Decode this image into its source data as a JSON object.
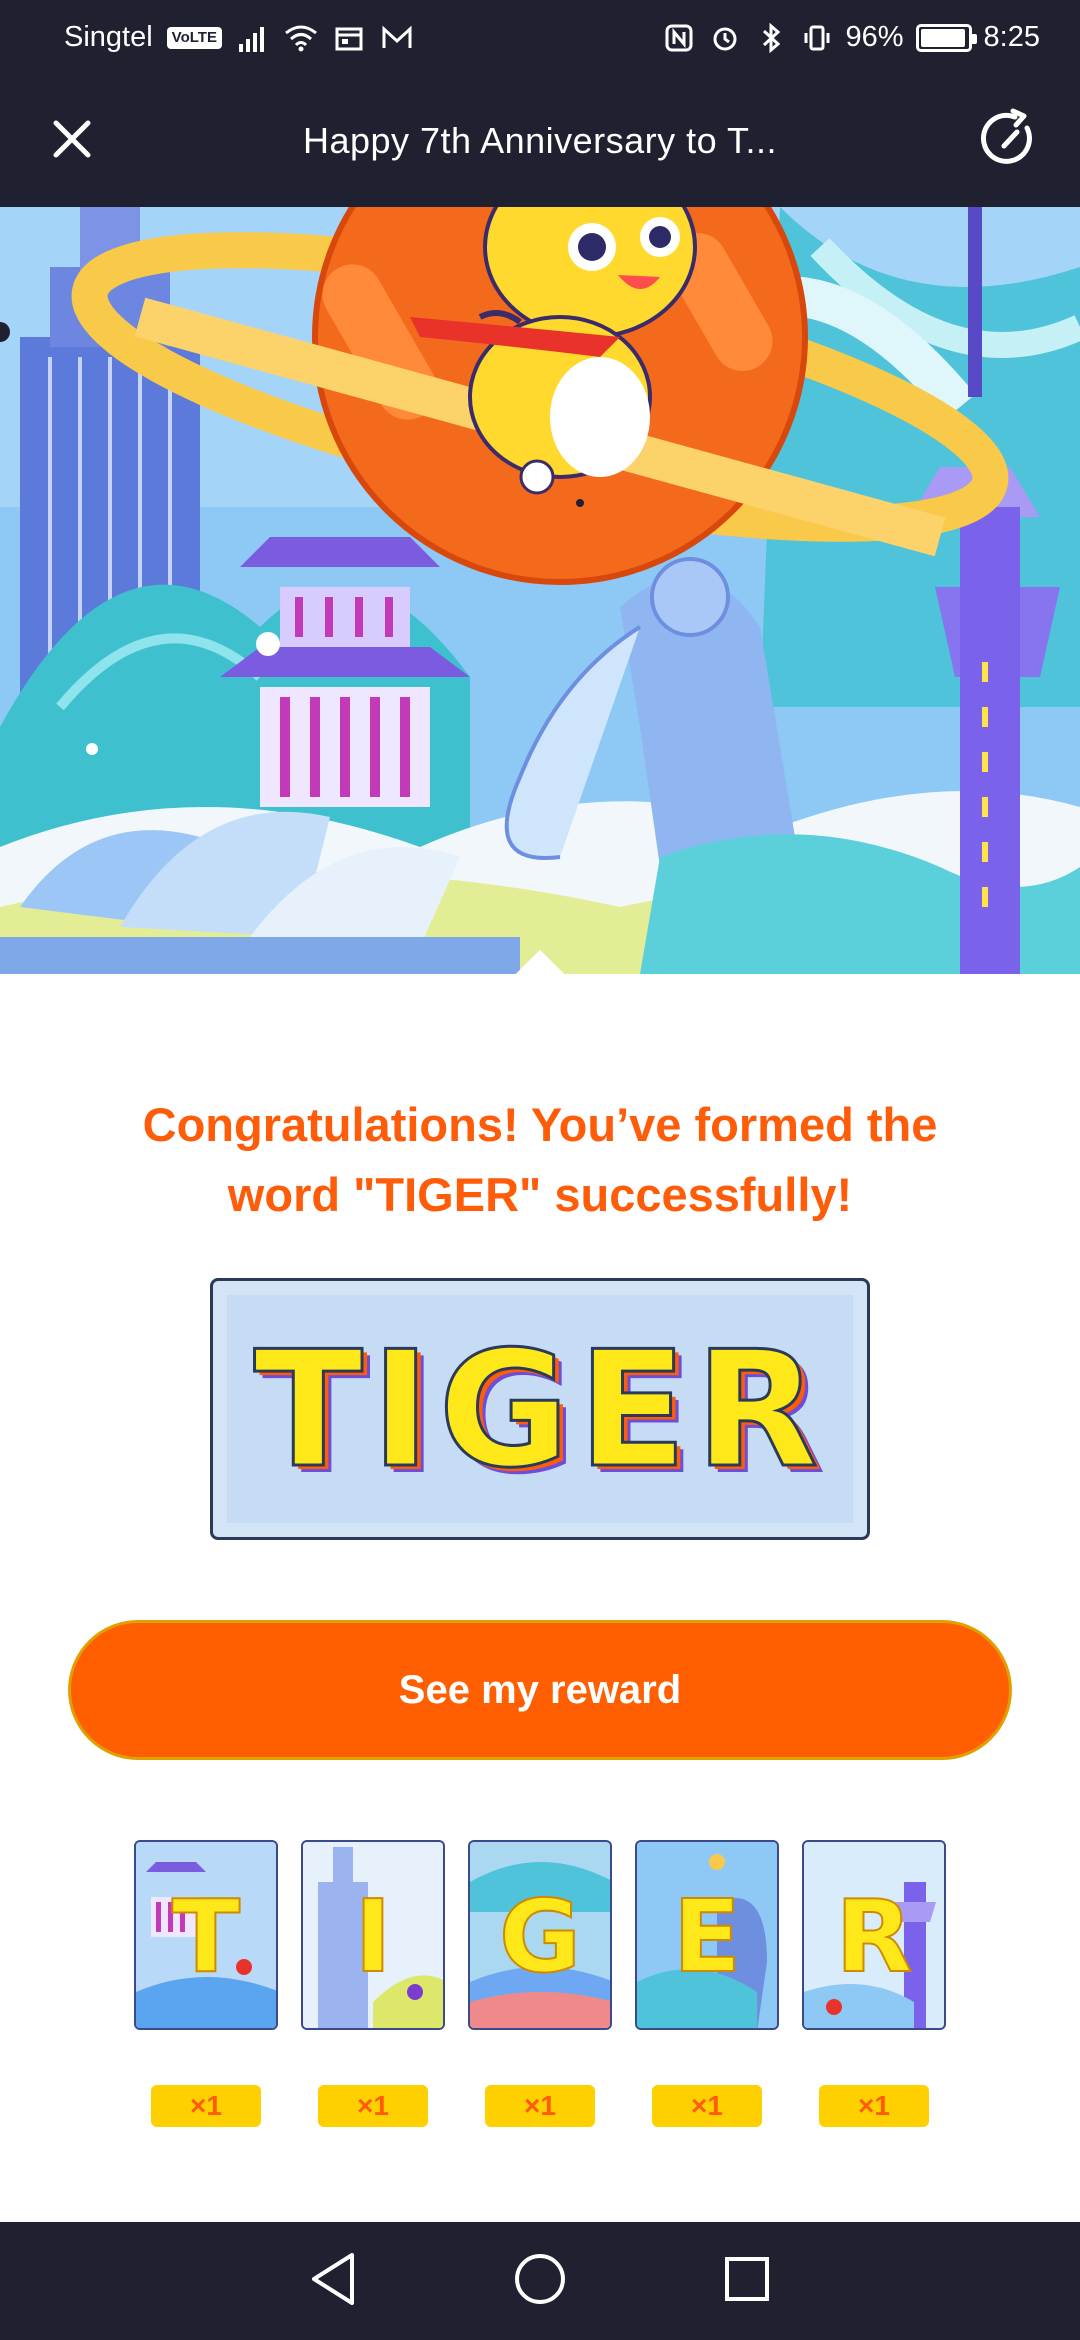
{
  "status_bar": {
    "carrier": "Singtel",
    "volte_label": "VoLTE",
    "battery_text": "96%",
    "battery_level": 0.96,
    "time": "8:25"
  },
  "header": {
    "title": "Happy 7th Anniversary to T..."
  },
  "main": {
    "congrats_line1": "Congratulations! You’ve formed the",
    "congrats_line2": "word \"TIGER\" successfully!",
    "word": "TIGER",
    "reward_button_label": "See my reward"
  },
  "cards": [
    {
      "letter": "T",
      "count": "×1"
    },
    {
      "letter": "I",
      "count": "×1"
    },
    {
      "letter": "G",
      "count": "×1"
    },
    {
      "letter": "E",
      "count": "×1"
    },
    {
      "letter": "R",
      "count": "×1"
    }
  ],
  "colors": {
    "accent": "#ff5f00",
    "title_text": "#ff5c0a",
    "bar_bg": "#1f2130",
    "badge": "#ffd000",
    "letter_yellow": "#ffe81a"
  },
  "icons": {
    "header_left": "close-icon",
    "header_right": "refresh-icon",
    "nav": [
      "back-icon",
      "home-icon",
      "recents-icon"
    ]
  }
}
